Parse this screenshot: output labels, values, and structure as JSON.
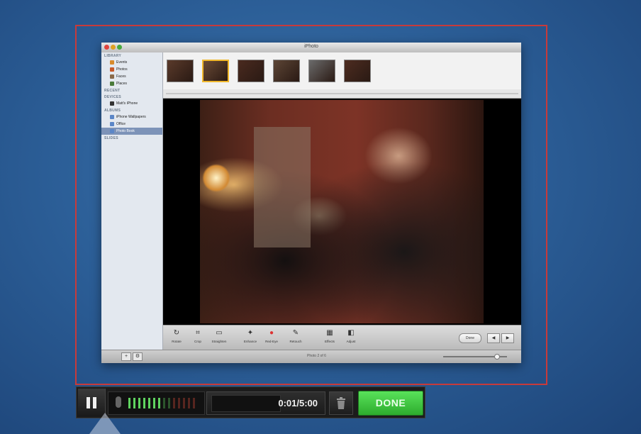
{
  "window": {
    "title": "iPhoto"
  },
  "sidebar": {
    "sections": [
      {
        "label": "LIBRARY",
        "items": [
          {
            "label": "Events",
            "color": "#d88b2c"
          },
          {
            "label": "Photos",
            "color": "#c75a2a"
          },
          {
            "label": "Faces",
            "color": "#8a6a4a"
          },
          {
            "label": "Places",
            "color": "#4a7a3a"
          }
        ]
      },
      {
        "label": "RECENT",
        "items": []
      },
      {
        "label": "DEVICES",
        "items": [
          {
            "label": "Matt's iPhone",
            "color": "#333333"
          }
        ]
      },
      {
        "label": "ALBUMS",
        "items": [
          {
            "label": "iPhone Wallpapers",
            "color": "#5b86c7"
          },
          {
            "label": "Office",
            "color": "#5b86c7"
          },
          {
            "label": "Photo Book",
            "color": "#5b86c7",
            "selected": true
          }
        ]
      },
      {
        "label": "SLIDES",
        "items": []
      }
    ]
  },
  "thumbnails": [
    {
      "name": "photo-1",
      "color": "#5a3a2a"
    },
    {
      "name": "photo-2",
      "color": "#6a4a35",
      "selected": true
    },
    {
      "name": "photo-3",
      "color": "#4a2a1f"
    },
    {
      "name": "photo-4",
      "color": "#5c4535"
    },
    {
      "name": "photo-5",
      "color": "#6b6b6b"
    },
    {
      "name": "photo-6",
      "color": "#4d2c20"
    }
  ],
  "toolbar": {
    "tools": [
      {
        "label": "Rotate",
        "glyph": "↻",
        "icon": "rotate-icon"
      },
      {
        "label": "Crop",
        "glyph": "⌗",
        "icon": "crop-icon"
      },
      {
        "label": "Straighten",
        "glyph": "▭",
        "icon": "straighten-icon"
      },
      {
        "label": "Enhance",
        "glyph": "✦",
        "icon": "enhance-icon"
      },
      {
        "label": "Red-Eye",
        "glyph": "●",
        "icon": "red-eye-icon"
      },
      {
        "label": "Retouch",
        "glyph": "✎",
        "icon": "retouch-icon"
      },
      {
        "label": "Effects",
        "glyph": "▦",
        "icon": "effects-icon"
      },
      {
        "label": "Adjust",
        "glyph": "◧",
        "icon": "adjust-icon"
      }
    ],
    "done_label": "Done",
    "prev_label": "◀",
    "next_label": "▶"
  },
  "statusbar": {
    "add_label": "+",
    "gear_label": "⚙",
    "status_text": "Photo 2 of 6"
  },
  "recorder": {
    "time": "0:01/5:00",
    "done_label": "DONE",
    "level_bars_active": 7,
    "level_bars_total": 14,
    "colors": {
      "green": "#5fd35f",
      "red": "#d94a3a",
      "done": "#3fc43f"
    }
  }
}
